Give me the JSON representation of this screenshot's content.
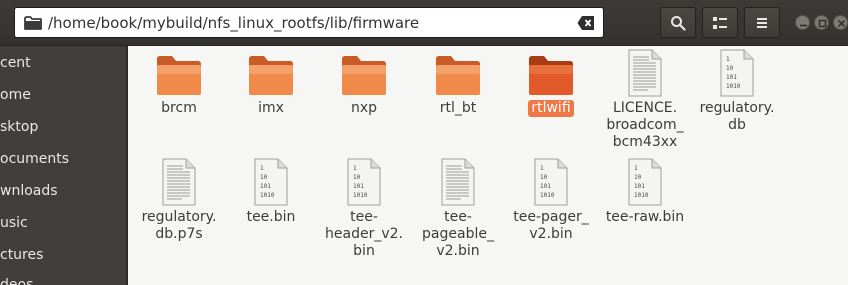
{
  "location": {
    "path": "/home/book/mybuild/nfs_linux_rootfs/lib/firmware"
  },
  "colors": {
    "folder": "#ef8a4a",
    "folder_selected": "#e35a2a",
    "selection": "#f07746"
  },
  "sidebar": {
    "items": [
      {
        "label": "cent",
        "icon": "recent-icon"
      },
      {
        "label": "ome",
        "icon": "home-icon"
      },
      {
        "label": "sktop",
        "icon": "desktop-icon"
      },
      {
        "label": "ocuments",
        "icon": "documents-icon"
      },
      {
        "label": "wnloads",
        "icon": "downloads-icon"
      },
      {
        "label": "usic",
        "icon": "music-icon"
      },
      {
        "label": "ctures",
        "icon": "pictures-icon"
      },
      {
        "label": "deos",
        "icon": "videos-icon"
      }
    ]
  },
  "files": [
    {
      "label_lines": [
        "brcm"
      ],
      "type": "folder"
    },
    {
      "label_lines": [
        "imx"
      ],
      "type": "folder"
    },
    {
      "label_lines": [
        "nxp"
      ],
      "type": "folder"
    },
    {
      "label_lines": [
        "rtl_bt"
      ],
      "type": "folder"
    },
    {
      "label_lines": [
        "rtlwifi"
      ],
      "type": "folder",
      "selected": true
    },
    {
      "label_lines": [
        "LICENCE.",
        "broadcom_",
        "bcm43xx"
      ],
      "type": "text"
    },
    {
      "label_lines": [
        "regulatory.",
        "db"
      ],
      "type": "binary"
    },
    {
      "label_lines": [
        "regulatory.",
        "db.p7s"
      ],
      "type": "text"
    },
    {
      "label_lines": [
        "tee.bin"
      ],
      "type": "binary"
    },
    {
      "label_lines": [
        "tee-",
        "header_v2.",
        "bin"
      ],
      "type": "binary"
    },
    {
      "label_lines": [
        "tee-",
        "pageable_",
        "v2.bin"
      ],
      "type": "text"
    },
    {
      "label_lines": [
        "tee-pager_",
        "v2.bin"
      ],
      "type": "binary"
    },
    {
      "label_lines": [
        "tee-raw.bin"
      ],
      "type": "binary"
    }
  ]
}
